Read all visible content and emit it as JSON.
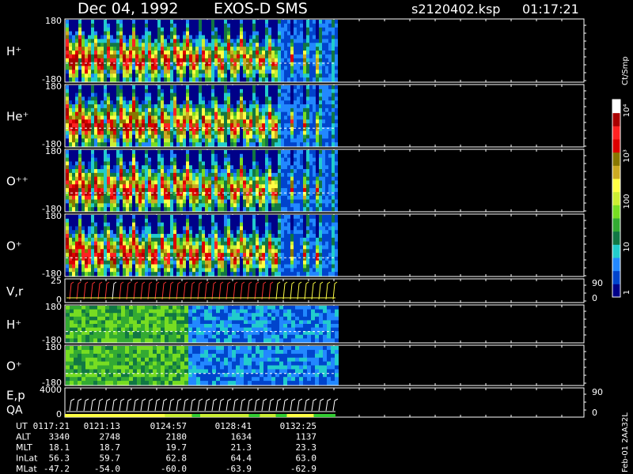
{
  "header": {
    "date": "Dec 04, 1992",
    "instrument": "EXOS-D SMS",
    "file": "s2120402.ksp",
    "time": "01:17:21"
  },
  "colorbar": {
    "unit": "Ct/Smp",
    "tick_labels": [
      "1",
      "10",
      "100",
      "10³",
      "10⁴"
    ],
    "colors": [
      "#000088",
      "#0044cc",
      "#2288ff",
      "#22cccc",
      "#117744",
      "#33aa33",
      "#77dd22",
      "#ccee33",
      "#ffff44",
      "#ccaa22",
      "#887700",
      "#dd0000",
      "#ff2222",
      "#aa0000",
      "#ffffff"
    ]
  },
  "footer": {
    "side_label": "Feb-01 2AA32L",
    "rows": [
      {
        "label": "UT",
        "values": [
          "0117:21",
          "0121:13",
          "0124:57",
          "0128:41",
          "0132:25"
        ]
      },
      {
        "label": "ALT",
        "values": [
          "3340",
          "2748",
          "2180",
          "1634",
          "1137"
        ]
      },
      {
        "label": "MLT",
        "values": [
          "18.1",
          "18.7",
          "19.7",
          "21.3",
          "23.3"
        ]
      },
      {
        "label": "InLat",
        "values": [
          "56.3",
          "59.7",
          "62.8",
          "64.4",
          "63.0"
        ]
      },
      {
        "label": "MLat",
        "values": [
          "-47.2",
          "-54.0",
          "-60.0",
          "-63.9",
          "-62.9"
        ]
      }
    ]
  },
  "chart_data": {
    "type": "heatmap",
    "title": "Dec 04, 1992   EXOS-D SMS",
    "x_range": [
      0,
      1
    ],
    "panels": [
      {
        "id": "h-plus",
        "label": "H⁺",
        "y_ticks": [
          "180",
          "-180"
        ],
        "y_range": [
          -180,
          180
        ],
        "pattern": "spin",
        "dashed_line": true
      },
      {
        "id": "he-plus",
        "label": "He⁺",
        "y_ticks": [
          "180",
          "-180"
        ],
        "y_range": [
          -180,
          180
        ],
        "pattern": "spin",
        "dashed_line": true
      },
      {
        "id": "o-plusplus",
        "label": "O⁺⁺",
        "y_ticks": [
          "180",
          "-180"
        ],
        "y_range": [
          -180,
          180
        ],
        "pattern": "spin",
        "dashed_line": true
      },
      {
        "id": "o-plus",
        "label": "O⁺",
        "y_ticks": [
          "180",
          "-180"
        ],
        "y_range": [
          -180,
          180
        ],
        "pattern": "spin",
        "dashed_line": true
      },
      {
        "id": "vr",
        "label": "V,r",
        "y_ticks": [
          "25",
          "0"
        ],
        "right_ticks": [
          "90",
          "0"
        ],
        "pattern": "sawtooth"
      },
      {
        "id": "h-plus-2",
        "label": "H⁺",
        "y_ticks": [
          "180",
          "-180"
        ],
        "y_range": [
          -180,
          180
        ],
        "pattern": "diffuse-green",
        "dashed_line": true
      },
      {
        "id": "o-plus-2",
        "label": "O⁺",
        "y_ticks": [
          "180",
          "-180"
        ],
        "y_range": [
          -180,
          180
        ],
        "pattern": "diffuse-green",
        "dashed_line": true
      },
      {
        "id": "ep-qa",
        "label": "E,p",
        "label2": "QA",
        "y_ticks": [
          "4000",
          "0"
        ],
        "right_ticks": [
          "90",
          "0"
        ],
        "pattern": "steps"
      }
    ]
  }
}
